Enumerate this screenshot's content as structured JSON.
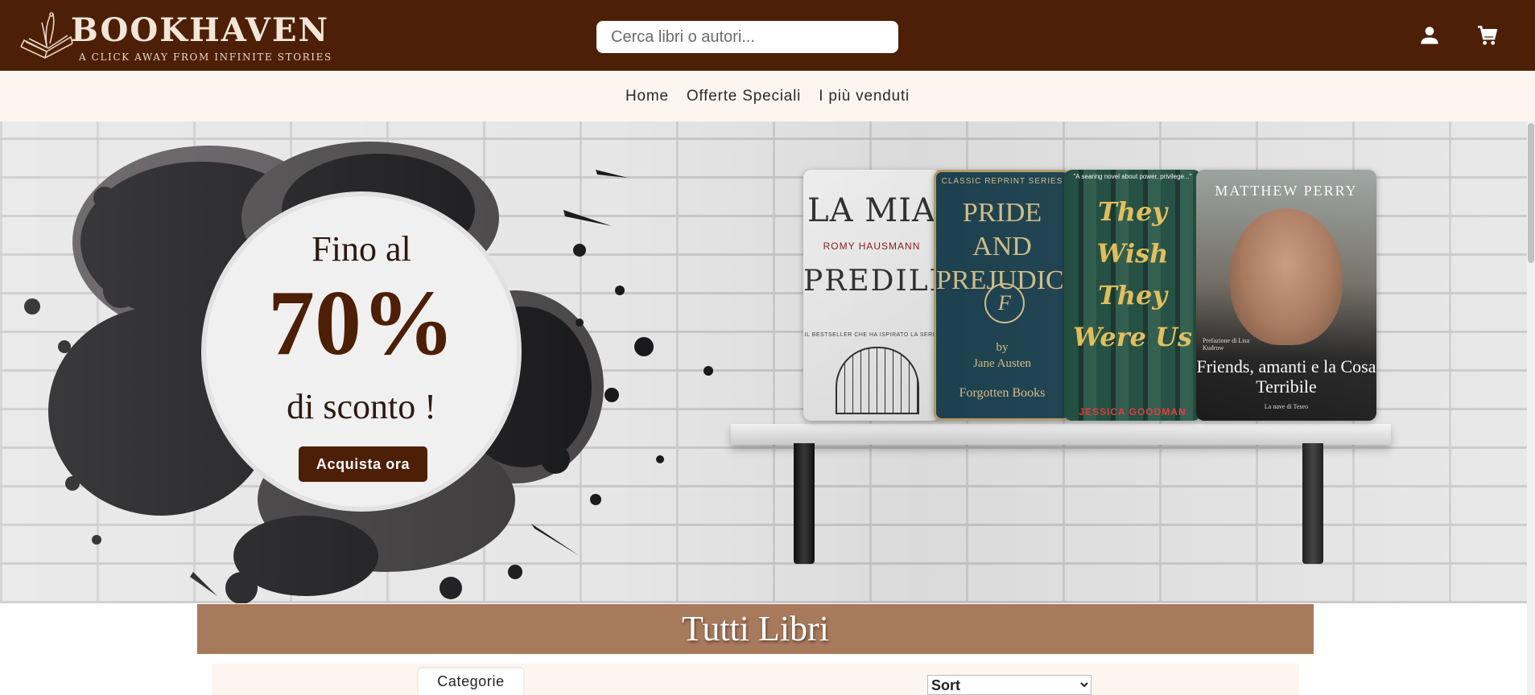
{
  "header": {
    "brand_name": "BOOKHAVEN",
    "tagline": "A CLICK AWAY FROM INFINITE STORIES",
    "search_placeholder": "Cerca libri o autori...",
    "icons": [
      "user-icon",
      "cart-icon"
    ],
    "background_color": "#4d1f06"
  },
  "nav": {
    "links": [
      "Home",
      "Offerte Speciali",
      "I più venduti"
    ]
  },
  "hero": {
    "promo_line1": "Fino al",
    "promo_percent": "70%",
    "promo_line3": "di sconto !",
    "cta_label": "Acquista ora",
    "books": [
      {
        "line1": "LA MIA",
        "author": "ROMY HAUSMANN",
        "line2": "PREDILETTA",
        "note": "IL BESTSELLER CHE HA ISPIRATO LA SERIE"
      },
      {
        "series": "CLASSIC REPRINT SERIES",
        "title": "PRIDE AND PREJUDICE",
        "emblem": "F",
        "by": "by",
        "author": "Jane Austen",
        "publisher": "Forgotten Books"
      },
      {
        "blurb": "\"A searing novel about power, privilege...\"",
        "title": "They Wish They Were Us",
        "author": "JESSICA GOODMAN"
      },
      {
        "author": "MATTHEW PERRY",
        "prefazione": "Prefazione di Lisa Kudrow",
        "title": "Friends, amanti e la Cosa Terribile",
        "publisher": "La nave di Teseo"
      }
    ]
  },
  "section": {
    "title": "Tutti Libri",
    "categories_label": "Categorie",
    "sort_selected": "Sort"
  },
  "colors": {
    "brand": "#4d1f06",
    "nav_background": "#fdf5f0",
    "section_banner": "#a87a5c"
  }
}
